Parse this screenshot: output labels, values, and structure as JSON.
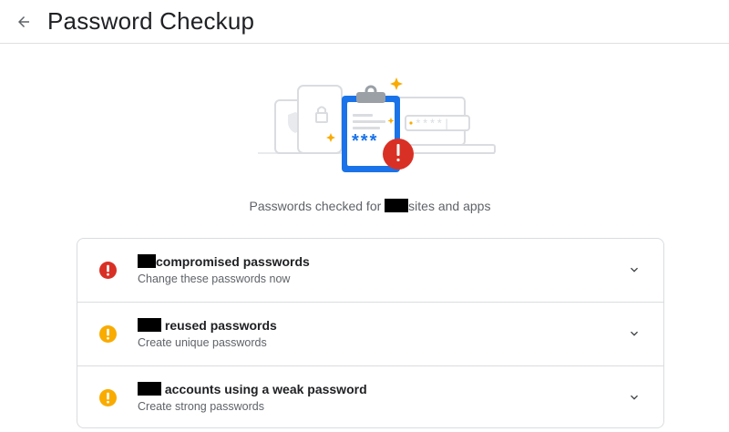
{
  "header": {
    "title": "Password Checkup",
    "back_icon": "arrow-back-icon"
  },
  "illustration": {
    "icon": "password-checkup-illustration",
    "clipboard_text": "***",
    "monitor_field_text": "****|"
  },
  "summary": {
    "prefix": "Passwords checked for",
    "suffix": "sites and apps"
  },
  "issues": [
    {
      "heading": "compromised passwords",
      "subtext": "Change these passwords now",
      "severity_color": "#d93025",
      "icon": "error-icon"
    },
    {
      "heading": "reused passwords",
      "subtext": "Create unique passwords",
      "severity_color": "#f9ab00",
      "icon": "warning-icon"
    },
    {
      "heading": "accounts using a weak password",
      "subtext": "Create strong passwords",
      "severity_color": "#f9ab00",
      "icon": "warning-icon"
    }
  ],
  "colors": {
    "accent_blue": "#1a73e8",
    "error_red": "#d93025",
    "warning_yellow": "#f9ab00",
    "divider": "#dadce0"
  }
}
